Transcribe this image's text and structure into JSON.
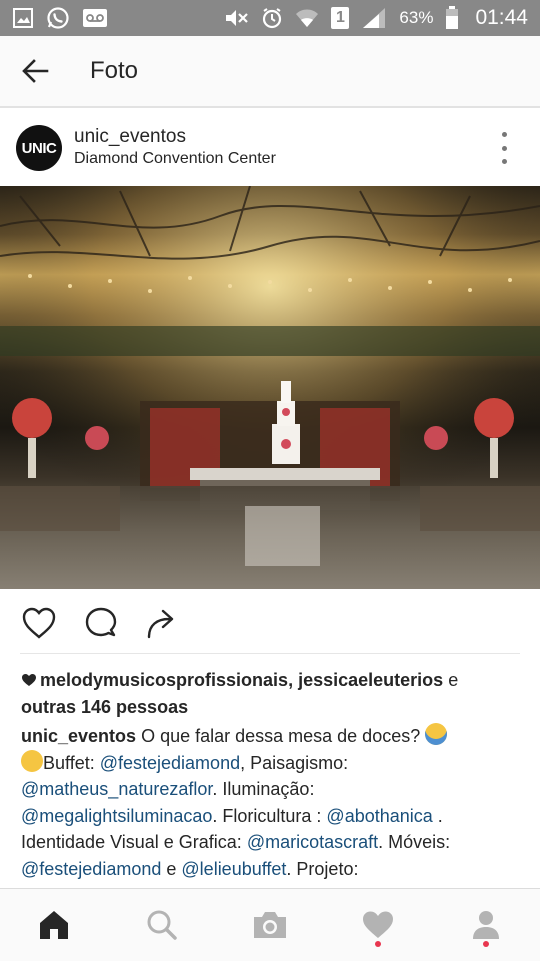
{
  "status_bar": {
    "battery": "63%",
    "time": "01:44",
    "sim_badge": "1"
  },
  "app_bar": {
    "title": "Foto"
  },
  "post": {
    "username": "unic_eventos",
    "location": "Diamond Convention Center",
    "avatar_text": "UNIC",
    "likes": {
      "names": "melodymusicosprofissionais, jessicaeleuterios",
      "conjunction": "e",
      "others": "outras 146 pessoas"
    },
    "caption": {
      "author": "unic_eventos",
      "t1": "O que falar dessa mesa de doces?",
      "t2": "Buffet:",
      "m1": "@festejediamond",
      "t3": ",  Paisagismo:",
      "m2": "@matheus_naturezaflor",
      "t4": ". Iluminação:",
      "m3": "@megalightsiluminacao",
      "t5": ". Floricultura :",
      "m4": "@abothanica",
      "t6": ". Identidade Visual e Grafica:",
      "m5": "@maricotascraft",
      "t7": ". Móveis:",
      "m6": "@festejediamond",
      "t8": "e",
      "m7": "@lelieubuffet",
      "t9": ". Projeto:"
    }
  },
  "icons": {
    "status_left": [
      "image-icon",
      "whatsapp-icon",
      "voicemail-icon"
    ],
    "status_right": [
      "mute-icon",
      "alarm-icon",
      "wifi-icon",
      "signal-icon",
      "battery-icon"
    ],
    "actions": [
      "heart-icon",
      "comment-icon",
      "share-icon"
    ],
    "bottom_nav": [
      "home-icon",
      "search-icon",
      "camera-icon",
      "activity-heart-icon",
      "profile-icon"
    ]
  },
  "colors": {
    "status_bar": "#888888",
    "mention": "#1a4f7a",
    "notification_dot": "#e8364f"
  }
}
